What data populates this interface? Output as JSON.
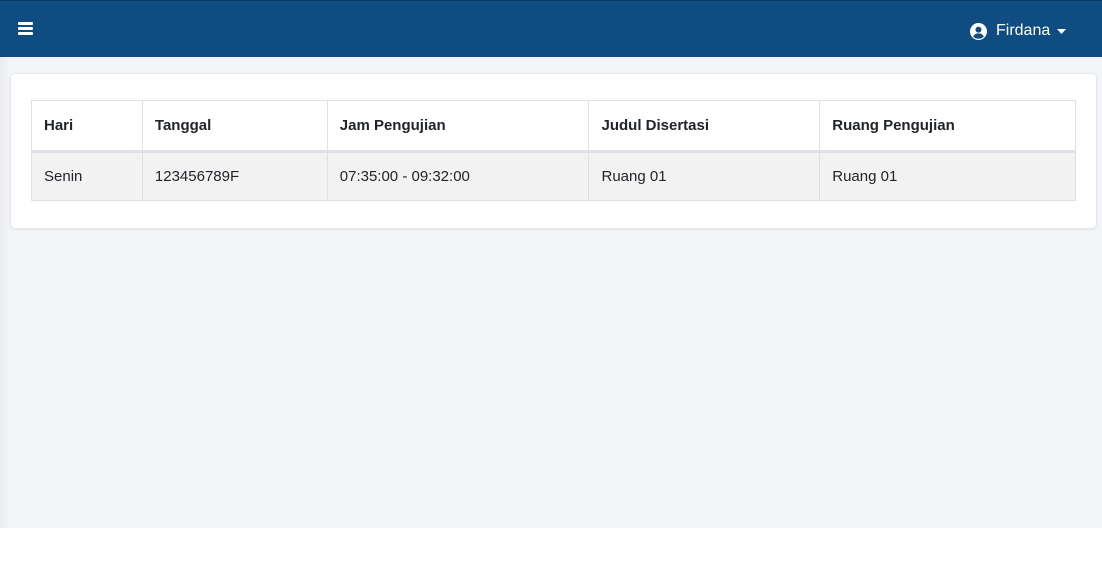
{
  "header": {
    "menu_icon": "hamburger-icon",
    "user_icon": "user-circle-icon",
    "user_name": "Firdana",
    "dropdown_icon": "caret-down-icon",
    "bg_color": "#0f4c81"
  },
  "table": {
    "headers": [
      "Hari",
      "Tanggal",
      "Jam Pengujian",
      "Judul Disertasi",
      "Ruang Pengujian"
    ],
    "rows": [
      [
        "Senin",
        "123456789F",
        "07:35:00 - 09:32:00",
        "Ruang 01",
        "Ruang 01"
      ]
    ]
  }
}
